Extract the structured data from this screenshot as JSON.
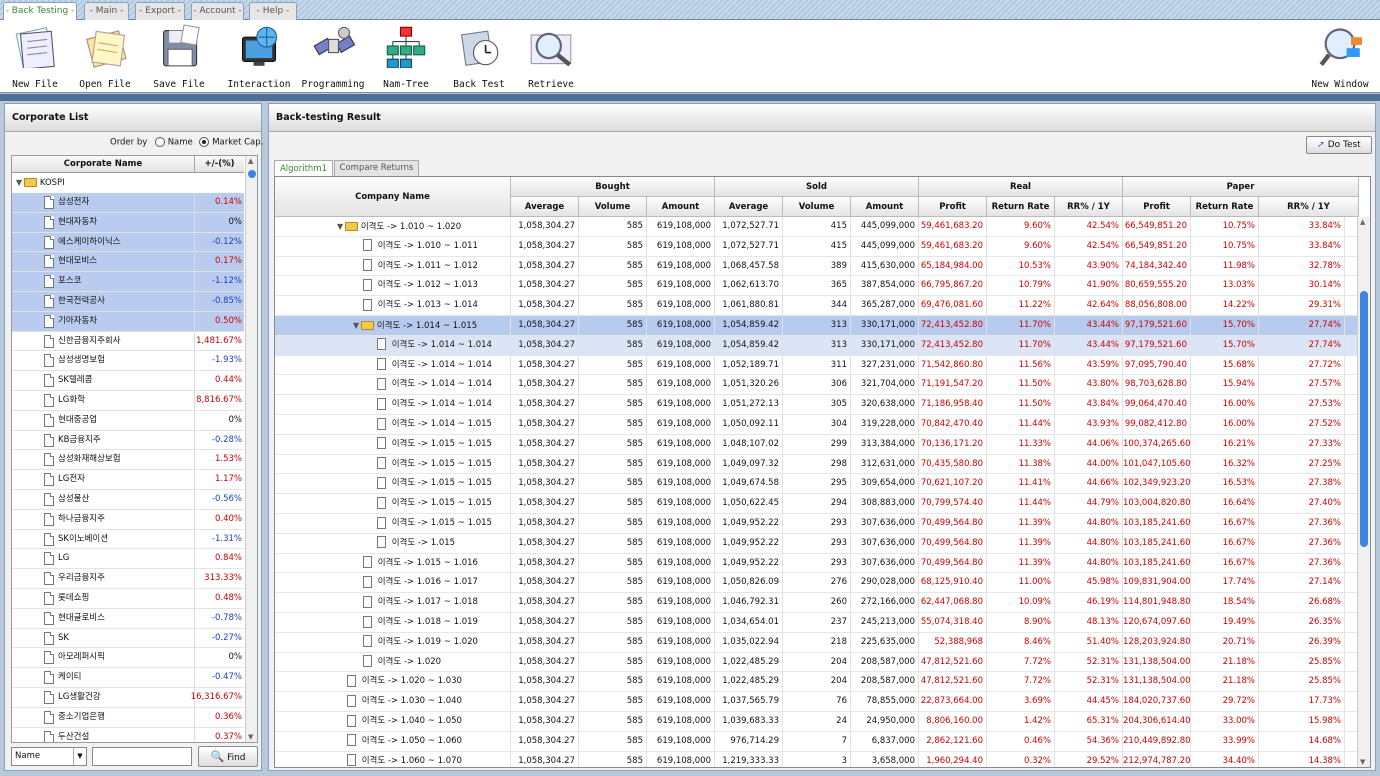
{
  "menu_tabs": [
    "- Back Testing -",
    "- Main -",
    "- Export -",
    "- Account -",
    "- Help -"
  ],
  "toolbar": {
    "tools": [
      {
        "label": "New File",
        "icon": "notepad-icon"
      },
      {
        "label": "Open File",
        "icon": "open-notes-icon"
      },
      {
        "label": "Save File",
        "icon": "floppy-disk-icon"
      },
      {
        "label": "Interaction",
        "icon": "monitor-globe-icon"
      },
      {
        "label": "Programming",
        "icon": "satellite-icon"
      },
      {
        "label": "Nam-Tree",
        "icon": "org-tree-icon"
      },
      {
        "label": "Back Test",
        "icon": "clock-icon"
      },
      {
        "label": "Retrieve",
        "icon": "magnifier-icon"
      }
    ],
    "new_window": {
      "label": "New Window",
      "icon": "new-window-icon"
    }
  },
  "left": {
    "title": "Corporate List",
    "order_by": "Order by",
    "opt_name": "Name",
    "opt_market": "Market Cap.",
    "col_name": "Corporate Name",
    "col_pct": "+/-(%)",
    "root": "KOSPI",
    "items": [
      {
        "name": "삼성전자",
        "pct": "0.14%",
        "c": "red",
        "sel": true
      },
      {
        "name": "현대자동차",
        "pct": "0%",
        "c": "",
        "sel": true
      },
      {
        "name": "에스케이하이닉스",
        "pct": "-0.12%",
        "c": "blue",
        "sel": true
      },
      {
        "name": "현대모비스",
        "pct": "0.17%",
        "c": "red",
        "sel": true
      },
      {
        "name": "포스코",
        "pct": "-1.12%",
        "c": "blue",
        "sel": true
      },
      {
        "name": "한국전력공사",
        "pct": "-0.85%",
        "c": "blue",
        "sel": true
      },
      {
        "name": "기아자동차",
        "pct": "0.50%",
        "c": "red",
        "sel": true
      },
      {
        "name": "신한금융지주회사",
        "pct": "1,481.67%",
        "c": "red",
        "sel": false
      },
      {
        "name": "삼성생명보험",
        "pct": "-1.93%",
        "c": "blue",
        "sel": false
      },
      {
        "name": "SK텔레콤",
        "pct": "0.44%",
        "c": "red",
        "sel": false
      },
      {
        "name": "LG화학",
        "pct": "8,816.67%",
        "c": "red",
        "sel": false
      },
      {
        "name": "현대중공업",
        "pct": "0%",
        "c": "",
        "sel": false
      },
      {
        "name": "KB금융지주",
        "pct": "-0.28%",
        "c": "blue",
        "sel": false
      },
      {
        "name": "삼성화재해상보험",
        "pct": "1.53%",
        "c": "red",
        "sel": false
      },
      {
        "name": "LG전자",
        "pct": "1.17%",
        "c": "red",
        "sel": false
      },
      {
        "name": "삼성물산",
        "pct": "-0.56%",
        "c": "blue",
        "sel": false
      },
      {
        "name": "하나금융지주",
        "pct": "0.40%",
        "c": "red",
        "sel": false
      },
      {
        "name": "SK이노베이션",
        "pct": "-1.31%",
        "c": "blue",
        "sel": false
      },
      {
        "name": "LG",
        "pct": "0.84%",
        "c": "red",
        "sel": false
      },
      {
        "name": "우리금융지주",
        "pct": "313.33%",
        "c": "red",
        "sel": false
      },
      {
        "name": "롯데쇼핑",
        "pct": "0.48%",
        "c": "red",
        "sel": false
      },
      {
        "name": "현대글로비스",
        "pct": "-0.78%",
        "c": "blue",
        "sel": false
      },
      {
        "name": "SK",
        "pct": "-0.27%",
        "c": "blue",
        "sel": false
      },
      {
        "name": "아모레퍼시픽",
        "pct": "0%",
        "c": "",
        "sel": false
      },
      {
        "name": "케이티",
        "pct": "-0.47%",
        "c": "blue",
        "sel": false
      },
      {
        "name": "LG생활건강",
        "pct": "16,316.67%",
        "c": "red",
        "sel": false
      },
      {
        "name": "중소기업은행",
        "pct": "0.36%",
        "c": "red",
        "sel": false
      },
      {
        "name": "두산건설",
        "pct": "0.37%",
        "c": "red",
        "sel": false
      }
    ],
    "search_select": "Name",
    "search_value": "",
    "find_label": "Find"
  },
  "right": {
    "title": "Back-testing Result",
    "do_test": "Do Test",
    "tabs": [
      "Algorithm1",
      "Compare Returns"
    ],
    "col_company": "Company Name",
    "groups": [
      "Bought",
      "Sold",
      "Real",
      "Paper"
    ],
    "subcols": [
      "Average",
      "Volume",
      "Amount",
      "Average",
      "Volume",
      "Amount",
      "Profit",
      "Return Rate",
      "RR% / 1Y",
      "Profit",
      "Return Rate",
      "RR% / 1Y"
    ],
    "rows": [
      {
        "lvl": 1,
        "type": "folder",
        "name": "이격도 -> 1.010 ~ 1.020",
        "v": [
          "1,058,304.27",
          "585",
          "619,108,000",
          "1,072,527.71",
          "415",
          "445,099,000",
          "59,461,683.20",
          "9.60%",
          "42.54%",
          "66,549,851.20",
          "10.75%",
          "33.84%"
        ]
      },
      {
        "lvl": 2,
        "type": "doc",
        "name": "이격도 -> 1.010 ~ 1.011",
        "v": [
          "1,058,304.27",
          "585",
          "619,108,000",
          "1,072,527.71",
          "415",
          "445,099,000",
          "59,461,683.20",
          "9.60%",
          "42.54%",
          "66,549,851.20",
          "10.75%",
          "33.84%"
        ]
      },
      {
        "lvl": 2,
        "type": "doc",
        "name": "이격도 -> 1.011 ~ 1.012",
        "v": [
          "1,058,304.27",
          "585",
          "619,108,000",
          "1,068,457.58",
          "389",
          "415,630,000",
          "65,184,984.00",
          "10.53%",
          "43.90%",
          "74,184,342.40",
          "11.98%",
          "32.78%"
        ]
      },
      {
        "lvl": 2,
        "type": "doc",
        "name": "이격도 -> 1.012 ~ 1.013",
        "v": [
          "1,058,304.27",
          "585",
          "619,108,000",
          "1,062,613.70",
          "365",
          "387,854,000",
          "66,795,867.20",
          "10.79%",
          "41.90%",
          "80,659,555.20",
          "13.03%",
          "30.14%"
        ]
      },
      {
        "lvl": 2,
        "type": "doc",
        "name": "이격도 -> 1.013 ~ 1.014",
        "v": [
          "1,058,304.27",
          "585",
          "619,108,000",
          "1,061,880.81",
          "344",
          "365,287,000",
          "69,476,081.60",
          "11.22%",
          "42.64%",
          "88,056,808.00",
          "14.22%",
          "29.31%"
        ]
      },
      {
        "lvl": 2,
        "type": "folder",
        "name": "이격도 -> 1.014 ~ 1.015",
        "sel": 1,
        "v": [
          "1,058,304.27",
          "585",
          "619,108,000",
          "1,054,859.42",
          "313",
          "330,171,000",
          "72,413,452.80",
          "11.70%",
          "43.44%",
          "97,179,521.60",
          "15.70%",
          "27.74%"
        ]
      },
      {
        "lvl": 3,
        "type": "doc",
        "name": "이격도 -> 1.014 ~ 1.014",
        "sel": 2,
        "v": [
          "1,058,304.27",
          "585",
          "619,108,000",
          "1,054,859.42",
          "313",
          "330,171,000",
          "72,413,452.80",
          "11.70%",
          "43.44%",
          "97,179,521.60",
          "15.70%",
          "27.74%"
        ]
      },
      {
        "lvl": 3,
        "type": "doc",
        "name": "이격도 -> 1.014 ~ 1.014",
        "v": [
          "1,058,304.27",
          "585",
          "619,108,000",
          "1,052,189.71",
          "311",
          "327,231,000",
          "71,542,860.80",
          "11.56%",
          "43.59%",
          "97,095,790.40",
          "15.68%",
          "27.72%"
        ]
      },
      {
        "lvl": 3,
        "type": "doc",
        "name": "이격도 -> 1.014 ~ 1.014",
        "v": [
          "1,058,304.27",
          "585",
          "619,108,000",
          "1,051,320.26",
          "306",
          "321,704,000",
          "71,191,547.20",
          "11.50%",
          "43.80%",
          "98,703,628.80",
          "15.94%",
          "27.57%"
        ]
      },
      {
        "lvl": 3,
        "type": "doc",
        "name": "이격도 -> 1.014 ~ 1.014",
        "v": [
          "1,058,304.27",
          "585",
          "619,108,000",
          "1,051,272.13",
          "305",
          "320,638,000",
          "71,186,958.40",
          "11.50%",
          "43.84%",
          "99,064,470.40",
          "16.00%",
          "27.53%"
        ]
      },
      {
        "lvl": 3,
        "type": "doc",
        "name": "이격도 -> 1.014 ~ 1.015",
        "v": [
          "1,058,304.27",
          "585",
          "619,108,000",
          "1,050,092.11",
          "304",
          "319,228,000",
          "70,842,470.40",
          "11.44%",
          "43.93%",
          "99,082,412.80",
          "16.00%",
          "27.52%"
        ]
      },
      {
        "lvl": 3,
        "type": "doc",
        "name": "이격도 -> 1.015 ~ 1.015",
        "v": [
          "1,058,304.27",
          "585",
          "619,108,000",
          "1,048,107.02",
          "299",
          "313,384,000",
          "70,136,171.20",
          "11.33%",
          "44.06%",
          "100,374,265.60",
          "16.21%",
          "27.33%"
        ]
      },
      {
        "lvl": 3,
        "type": "doc",
        "name": "이격도 -> 1.015 ~ 1.015",
        "v": [
          "1,058,304.27",
          "585",
          "619,108,000",
          "1,049,097.32",
          "298",
          "312,631,000",
          "70,435,580.80",
          "11.38%",
          "44.00%",
          "101,047,105.60",
          "16.32%",
          "27.25%"
        ]
      },
      {
        "lvl": 3,
        "type": "doc",
        "name": "이격도 -> 1.015 ~ 1.015",
        "v": [
          "1,058,304.27",
          "585",
          "619,108,000",
          "1,049,674.58",
          "295",
          "309,654,000",
          "70,621,107.20",
          "11.41%",
          "44.66%",
          "102,349,923.20",
          "16.53%",
          "27.38%"
        ]
      },
      {
        "lvl": 3,
        "type": "doc",
        "name": "이격도 -> 1.015 ~ 1.015",
        "v": [
          "1,058,304.27",
          "585",
          "619,108,000",
          "1,050,622.45",
          "294",
          "308,883,000",
          "70,799,574.40",
          "11.44%",
          "44.79%",
          "103,004,820.80",
          "16.64%",
          "27.40%"
        ]
      },
      {
        "lvl": 3,
        "type": "doc",
        "name": "이격도 -> 1.015 ~ 1.015",
        "v": [
          "1,058,304.27",
          "585",
          "619,108,000",
          "1,049,952.22",
          "293",
          "307,636,000",
          "70,499,564.80",
          "11.39%",
          "44.80%",
          "103,185,241.60",
          "16.67%",
          "27.36%"
        ]
      },
      {
        "lvl": 3,
        "type": "doc",
        "name": "이격도 -> 1.015",
        "v": [
          "1,058,304.27",
          "585",
          "619,108,000",
          "1,049,952.22",
          "293",
          "307,636,000",
          "70,499,564.80",
          "11.39%",
          "44.80%",
          "103,185,241.60",
          "16.67%",
          "27.36%"
        ]
      },
      {
        "lvl": 2,
        "type": "doc",
        "name": "이격도 -> 1.015 ~ 1.016",
        "v": [
          "1,058,304.27",
          "585",
          "619,108,000",
          "1,049,952.22",
          "293",
          "307,636,000",
          "70,499,564.80",
          "11.39%",
          "44.80%",
          "103,185,241.60",
          "16.67%",
          "27.36%"
        ]
      },
      {
        "lvl": 2,
        "type": "doc",
        "name": "이격도 -> 1.016 ~ 1.017",
        "v": [
          "1,058,304.27",
          "585",
          "619,108,000",
          "1,050,826.09",
          "276",
          "290,028,000",
          "68,125,910.40",
          "11.00%",
          "45.98%",
          "109,831,904.00",
          "17.74%",
          "27.14%"
        ]
      },
      {
        "lvl": 2,
        "type": "doc",
        "name": "이격도 -> 1.017 ~ 1.018",
        "v": [
          "1,058,304.27",
          "585",
          "619,108,000",
          "1,046,792.31",
          "260",
          "272,166,000",
          "62,447,068.80",
          "10.09%",
          "46.19%",
          "114,801,948.80",
          "18.54%",
          "26.68%"
        ]
      },
      {
        "lvl": 2,
        "type": "doc",
        "name": "이격도 -> 1.018 ~ 1.019",
        "v": [
          "1,058,304.27",
          "585",
          "619,108,000",
          "1,034,654.01",
          "237",
          "245,213,000",
          "55,074,318.40",
          "8.90%",
          "48.13%",
          "120,674,097.60",
          "19.49%",
          "26.35%"
        ]
      },
      {
        "lvl": 2,
        "type": "doc",
        "name": "이격도 -> 1.019 ~ 1.020",
        "v": [
          "1,058,304.27",
          "585",
          "619,108,000",
          "1,035,022.94",
          "218",
          "225,635,000",
          "52,388,968",
          "8.46%",
          "51.40%",
          "128,203,924.80",
          "20.71%",
          "26.39%"
        ]
      },
      {
        "lvl": 2,
        "type": "doc",
        "name": "이격도 -> 1.020",
        "v": [
          "1,058,304.27",
          "585",
          "619,108,000",
          "1,022,485.29",
          "204",
          "208,587,000",
          "47,812,521.60",
          "7.72%",
          "52.31%",
          "131,138,504.00",
          "21.18%",
          "25.85%"
        ]
      },
      {
        "lvl": 1,
        "type": "doc",
        "name": "이격도 -> 1.020 ~ 1.030",
        "v": [
          "1,058,304.27",
          "585",
          "619,108,000",
          "1,022,485.29",
          "204",
          "208,587,000",
          "47,812,521.60",
          "7.72%",
          "52.31%",
          "131,138,504.00",
          "21.18%",
          "25.85%"
        ]
      },
      {
        "lvl": 1,
        "type": "doc",
        "name": "이격도 -> 1.030 ~ 1.040",
        "v": [
          "1,058,304.27",
          "585",
          "619,108,000",
          "1,037,565.79",
          "76",
          "78,855,000",
          "22,873,664.00",
          "3.69%",
          "44.45%",
          "184,020,737.60",
          "29.72%",
          "17.73%"
        ]
      },
      {
        "lvl": 1,
        "type": "doc",
        "name": "이격도 -> 1.040 ~ 1.050",
        "v": [
          "1,058,304.27",
          "585",
          "619,108,000",
          "1,039,683.33",
          "24",
          "24,950,000",
          "8,806,160.00",
          "1.42%",
          "65.31%",
          "204,306,614.40",
          "33.00%",
          "15.98%"
        ]
      },
      {
        "lvl": 1,
        "type": "doc",
        "name": "이격도 -> 1.050 ~ 1.060",
        "v": [
          "1,058,304.27",
          "585",
          "619,108,000",
          "976,714.29",
          "7",
          "6,837,000",
          "2,862,121.60",
          "0.46%",
          "54.36%",
          "210,449,892.80",
          "33.99%",
          "14.68%"
        ]
      },
      {
        "lvl": 1,
        "type": "doc",
        "name": "이격도 -> 1.060 ~ 1.070",
        "v": [
          "1,058,304.27",
          "585",
          "619,108,000",
          "1,219,333.33",
          "3",
          "3,658,000",
          "1,960,294.40",
          "0.32%",
          "29.52%",
          "212,974,787.20",
          "34.40%",
          "14.38%"
        ]
      }
    ]
  },
  "colors": {
    "positive": "#cc0000",
    "negative": "#1a3fbf",
    "selection": "#b7cbef",
    "active_tab": "#3c8a2e"
  }
}
